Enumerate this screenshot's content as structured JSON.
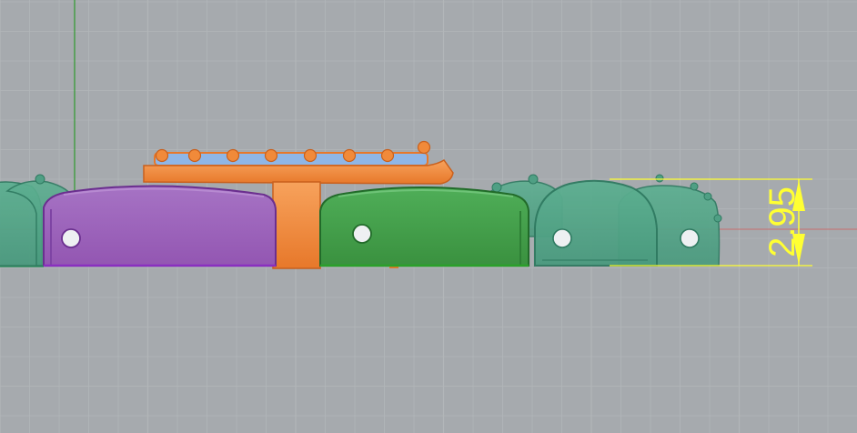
{
  "viewport": {
    "view": "front",
    "background_color": "#a6aaae",
    "grid": true,
    "grid_line_color": "#b2b6b9",
    "axis_colors": {
      "x": "#c86e6e",
      "y": "#2e9a2e"
    }
  },
  "parts": [
    {
      "name": "orange-bridge-part",
      "color": "#f18a3a"
    },
    {
      "name": "purple-key-part",
      "color": "#9a5cb8"
    },
    {
      "name": "green-key-part",
      "color": "#3f9a48"
    },
    {
      "name": "teal-key-parts",
      "color": "#4f9f84"
    }
  ],
  "dimension": {
    "value": "2.95",
    "color": "#ffff33"
  }
}
